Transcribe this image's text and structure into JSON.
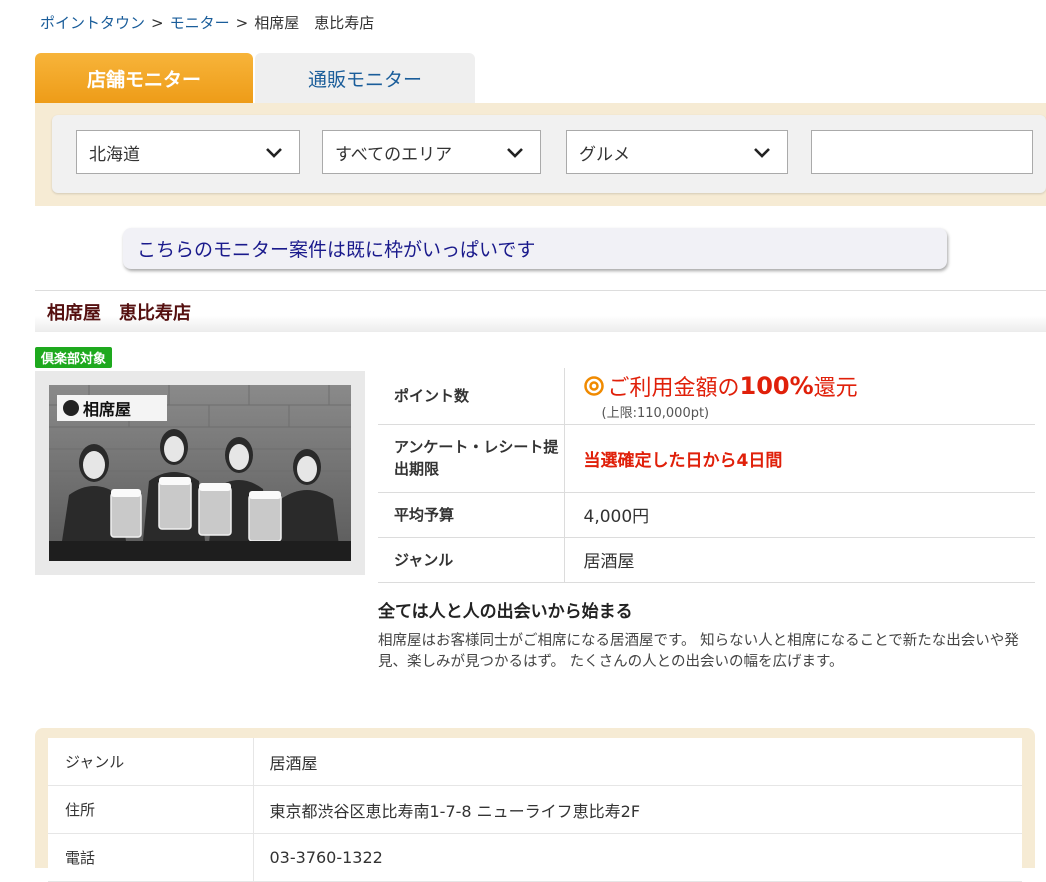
{
  "breadcrumb": {
    "items": [
      "ポイントタウン",
      "モニター",
      "相席屋　恵比寿店"
    ],
    "separator": ">"
  },
  "tabs": [
    {
      "label": "店舗モニター",
      "active": true
    },
    {
      "label": "通販モニター",
      "active": false
    }
  ],
  "filters": {
    "prefecture": "北海道",
    "area": "すべてのエリア",
    "category": "グルメ",
    "keyword": ""
  },
  "notice": "こちらのモニター案件は既に枠がいっぱいです",
  "store": {
    "title": "相席屋　恵比寿店",
    "badge": "倶楽部対象",
    "photo_logo": "相席屋"
  },
  "info": {
    "points_label": "ポイント数",
    "points_prefix": "ご利用金額の",
    "points_value": "100%",
    "points_suffix": "還元",
    "points_cap": "(上限:110,000pt)",
    "deadline_label": "アンケート・レシート提出期限",
    "deadline_value": "当選確定した日から4日間",
    "budget_label": "平均予算",
    "budget_value": "4,000円",
    "genre_label": "ジャンル",
    "genre_value": "居酒屋"
  },
  "catchcopy": "全ては人と人の出会いから始まる",
  "description": "相席屋はお客様同士がご相席になる居酒屋です。 知らない人と相席になることで新たな出会いや発見、楽しみが見つかるはず。 たくさんの人との出会いの幅を広げます。",
  "details": [
    {
      "label": "ジャンル",
      "value": "居酒屋"
    },
    {
      "label": "住所",
      "value": "東京都渋谷区恵比寿南1-7-8 ニューライフ恵比寿2F"
    },
    {
      "label": "電話",
      "value": "03-3760-1322"
    }
  ],
  "colors": {
    "accent_orange": "#f0a020",
    "link_blue": "#1a5d9a",
    "highlight_red": "#e0200a",
    "badge_green": "#1ea91e",
    "panel_beige": "#f6ebd4"
  }
}
